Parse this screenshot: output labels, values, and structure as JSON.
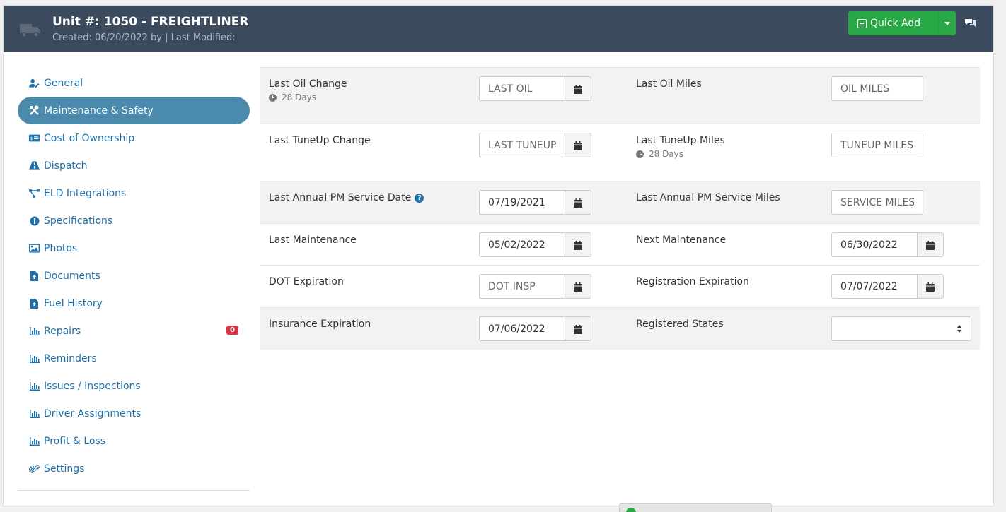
{
  "header": {
    "title": "Unit #: 1050 - FREIGHTLINER",
    "subtitle": "Created: 06/20/2022 by | Last Modified:",
    "quick_add_label": "Quick Add"
  },
  "sidebar": {
    "items": [
      {
        "label": "General",
        "icon": "user-edit-icon"
      },
      {
        "label": "Maintenance & Safety",
        "icon": "tools-icon",
        "active": true
      },
      {
        "label": "Cost of Ownership",
        "icon": "money-bill-icon"
      },
      {
        "label": "Dispatch",
        "icon": "road-icon"
      },
      {
        "label": "ELD Integrations",
        "icon": "network-icon"
      },
      {
        "label": "Specifications",
        "icon": "info-circle-icon"
      },
      {
        "label": "Photos",
        "icon": "image-icon"
      },
      {
        "label": "Documents",
        "icon": "file-upload-icon"
      },
      {
        "label": "Fuel History",
        "icon": "file-upload-icon"
      },
      {
        "label": "Repairs",
        "icon": "chart-bar-icon",
        "badge": "0"
      },
      {
        "label": "Reminders",
        "icon": "chart-bar-icon"
      },
      {
        "label": "Issues / Inspections",
        "icon": "chart-bar-icon"
      },
      {
        "label": "Driver Assignments",
        "icon": "chart-bar-icon"
      },
      {
        "label": "Profit & Loss",
        "icon": "chart-bar-icon"
      },
      {
        "label": "Settings",
        "icon": "cogs-icon"
      }
    ]
  },
  "form": {
    "last_oil_change": {
      "label": "Last Oil Change",
      "note": "28 Days",
      "placeholder": "LAST OIL",
      "value": ""
    },
    "last_oil_miles": {
      "label": "Last Oil Miles",
      "placeholder": "OIL MILES",
      "value": ""
    },
    "last_tuneup_change": {
      "label": "Last TuneUp Change",
      "placeholder": "LAST TUNEUP",
      "value": ""
    },
    "last_tuneup_miles": {
      "label": "Last TuneUp Miles",
      "note": "28 Days",
      "placeholder": "TUNEUP MILES",
      "value": ""
    },
    "last_annual_pm_date": {
      "label": "Last Annual PM Service Date",
      "value": "07/19/2021"
    },
    "last_annual_pm_miles": {
      "label": "Last Annual PM Service Miles",
      "placeholder": "SERVICE MILES",
      "value": ""
    },
    "last_maintenance": {
      "label": "Last Maintenance",
      "value": "05/02/2022"
    },
    "next_maintenance": {
      "label": "Next Maintenance",
      "value": "06/30/2022"
    },
    "dot_expiration": {
      "label": "DOT Expiration",
      "placeholder": "DOT INSP",
      "value": ""
    },
    "registration_expiration": {
      "label": "Registration Expiration",
      "value": "07/07/2022"
    },
    "insurance_expiration": {
      "label": "Insurance Expiration",
      "value": "07/06/2022"
    },
    "registered_states": {
      "label": "Registered States",
      "value": ""
    }
  },
  "colors": {
    "header_bg": "#3b4a5c",
    "quick_add_green": "#27a844",
    "active_nav": "#4a8bad",
    "link_blue": "#1f6fa8",
    "badge_red": "#dc3545"
  }
}
